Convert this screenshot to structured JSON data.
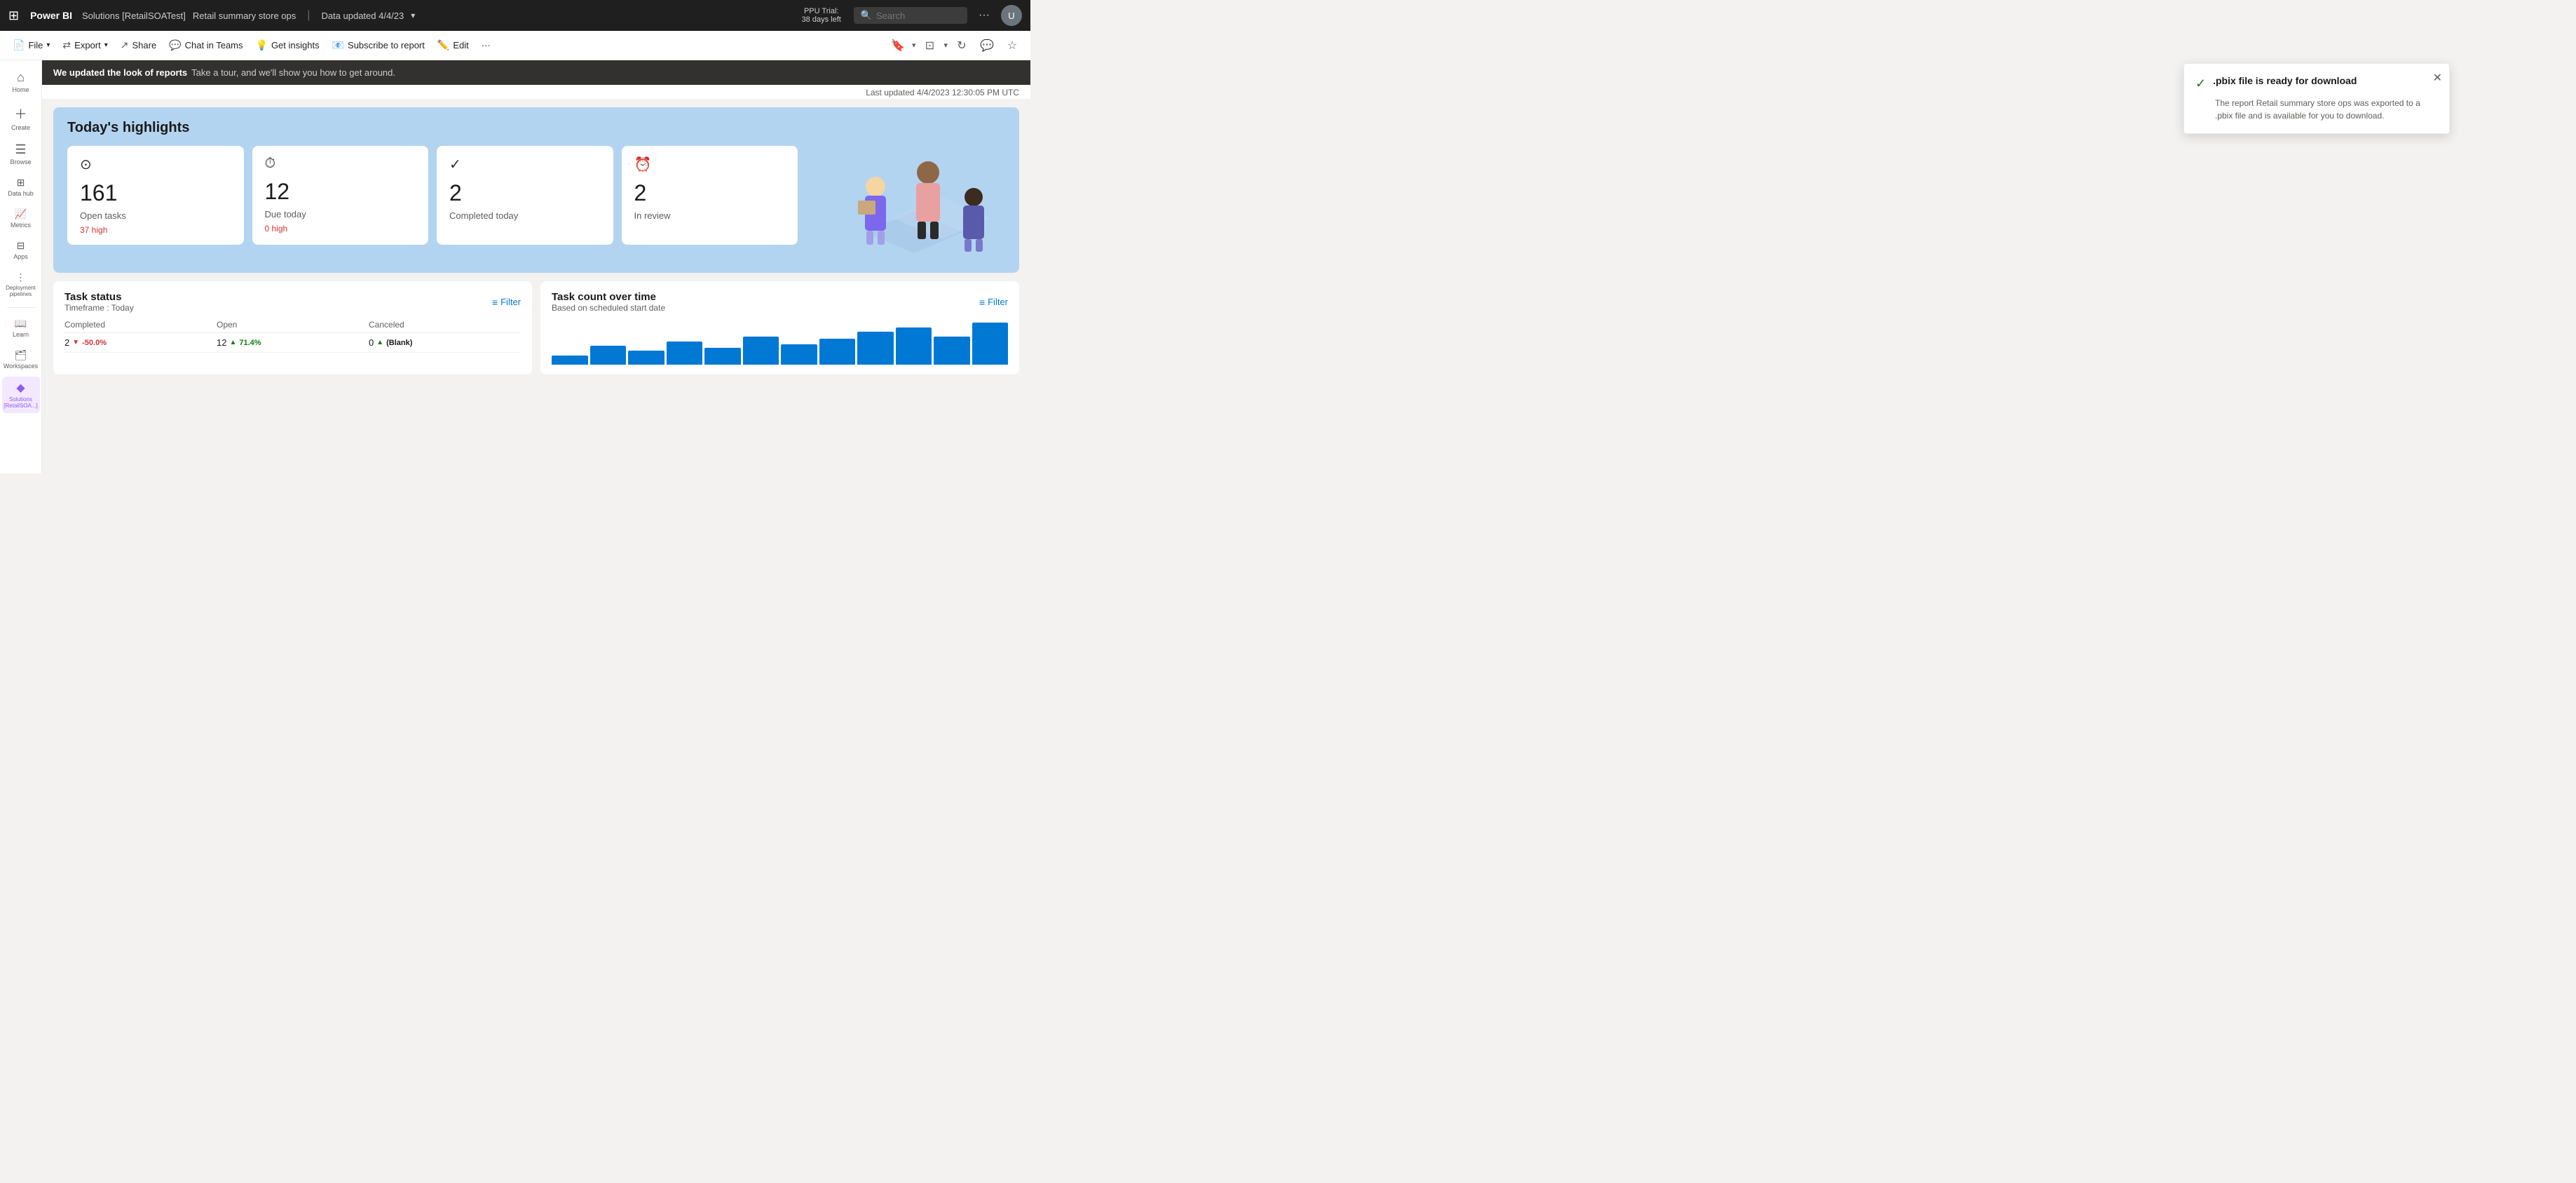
{
  "topNav": {
    "brand": "Power BI",
    "workspace": "Solutions [RetailSOATest]",
    "report_title": "Retail summary store ops",
    "separator": "|",
    "data_updated": "Data updated 4/4/23",
    "trial_line1": "PPU Trial:",
    "trial_line2": "38 days left",
    "search_placeholder": "Search",
    "more_icon": "···",
    "avatar_initials": "U"
  },
  "toolbar": {
    "file_label": "File",
    "export_label": "Export",
    "share_label": "Share",
    "chat_label": "Chat in Teams",
    "insights_label": "Get insights",
    "subscribe_label": "Subscribe to report",
    "edit_label": "Edit",
    "more_label": "···"
  },
  "banner": {
    "bold": "We updated the look of reports",
    "text": "Take a tour, and we'll show you how to get around."
  },
  "lastUpdated": "Last updated 4/4/2023 12:30:05 PM UTC",
  "highlights": {
    "title": "Today's highlights",
    "cards": [
      {
        "icon": "⊙",
        "number": "161",
        "label": "Open tasks",
        "sub": "37 high",
        "sub_type": "red"
      },
      {
        "icon": "⏱",
        "number": "12",
        "label": "Due today",
        "sub": "0 high",
        "sub_type": "red"
      },
      {
        "icon": "✓",
        "number": "2",
        "label": "Completed today",
        "sub": "",
        "sub_type": ""
      },
      {
        "icon": "⏰",
        "number": "2",
        "label": "In review",
        "sub": "",
        "sub_type": ""
      }
    ]
  },
  "taskStatus": {
    "title": "Task status",
    "subtitle": "Timeframe : Today",
    "filter_label": "Filter",
    "columns": [
      "Completed",
      "Open",
      "Canceled"
    ],
    "rows": [
      {
        "completed": "2",
        "completed_pct": "-50.0%",
        "completed_dir": "down",
        "open": "12",
        "open_pct": "71.4%",
        "open_dir": "up",
        "canceled": "0",
        "canceled_pct": "(Blank)",
        "canceled_dir": "up"
      }
    ]
  },
  "taskCountOverTime": {
    "title": "Task count over time",
    "subtitle": "Based on scheduled start date",
    "filter_label": "Filter",
    "chart_bars": [
      10,
      20,
      15,
      25,
      18,
      30,
      22,
      28,
      35,
      40,
      30,
      45
    ]
  },
  "sidebar": {
    "items": [
      {
        "id": "home",
        "icon": "⌂",
        "label": "Home",
        "active": false
      },
      {
        "id": "create",
        "icon": "+",
        "label": "Create",
        "active": false
      },
      {
        "id": "browse",
        "icon": "☰",
        "label": "Browse",
        "active": false
      },
      {
        "id": "datahub",
        "icon": "⊞",
        "label": "Data hub",
        "active": false
      },
      {
        "id": "metrics",
        "icon": "📊",
        "label": "Metrics",
        "active": false
      },
      {
        "id": "apps",
        "icon": "⊡",
        "label": "Apps",
        "active": false
      },
      {
        "id": "deployment",
        "icon": "⋮",
        "label": "Deployment pipelines",
        "active": false
      },
      {
        "id": "learn",
        "icon": "📖",
        "label": "Learn",
        "active": false
      },
      {
        "id": "workspaces",
        "icon": "⊟",
        "label": "Workspaces",
        "active": false
      },
      {
        "id": "solutions",
        "icon": "◆",
        "label": "Solutions [RetailSOA...]",
        "active": true,
        "special": true
      }
    ]
  }
}
